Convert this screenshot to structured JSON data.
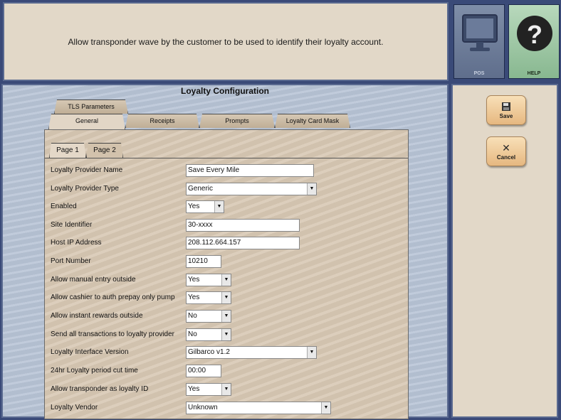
{
  "message": "Allow transponder wave by the customer to be used to identify their loyalty account.",
  "top_buttons": {
    "pos": "POS",
    "help": "HELP"
  },
  "actions": {
    "save": "Save",
    "cancel": "Cancel"
  },
  "title": "Loyalty Configuration",
  "tabs": {
    "tls": "TLS Parameters",
    "general": "General",
    "receipts": "Receipts",
    "prompts": "Prompts",
    "mask": "Loyalty Card Mask"
  },
  "pages": {
    "page1": "Page 1",
    "page2": "Page 2"
  },
  "fields": {
    "provider_name": {
      "label": "Loyalty Provider Name",
      "value": "Save Every Mile"
    },
    "provider_type": {
      "label": "Loyalty Provider Type",
      "value": "Generic"
    },
    "enabled": {
      "label": "Enabled",
      "value": "Yes"
    },
    "site_id": {
      "label": "Site Identifier",
      "value": "30-xxxx"
    },
    "host_ip": {
      "label": "Host IP Address",
      "value": "208.112.664.157"
    },
    "port": {
      "label": "Port Number",
      "value": "10210"
    },
    "manual_entry": {
      "label": "Allow manual entry outside",
      "value": "Yes"
    },
    "cashier_prepay": {
      "label": "Allow cashier to auth prepay only pump",
      "value": "Yes"
    },
    "instant_rewards": {
      "label": "Allow instant rewards outside",
      "value": "No"
    },
    "send_all": {
      "label": "Send all transactions to loyalty provider",
      "value": "No"
    },
    "interface_version": {
      "label": "Loyalty Interface Version",
      "value": "Gilbarco v1.2"
    },
    "cut_time": {
      "label": "24hr Loyalty period cut time",
      "value": "00:00"
    },
    "transponder": {
      "label": "Allow transponder as loyalty ID",
      "value": "Yes"
    },
    "vendor": {
      "label": "Loyalty Vendor",
      "value": "Unknown"
    }
  }
}
